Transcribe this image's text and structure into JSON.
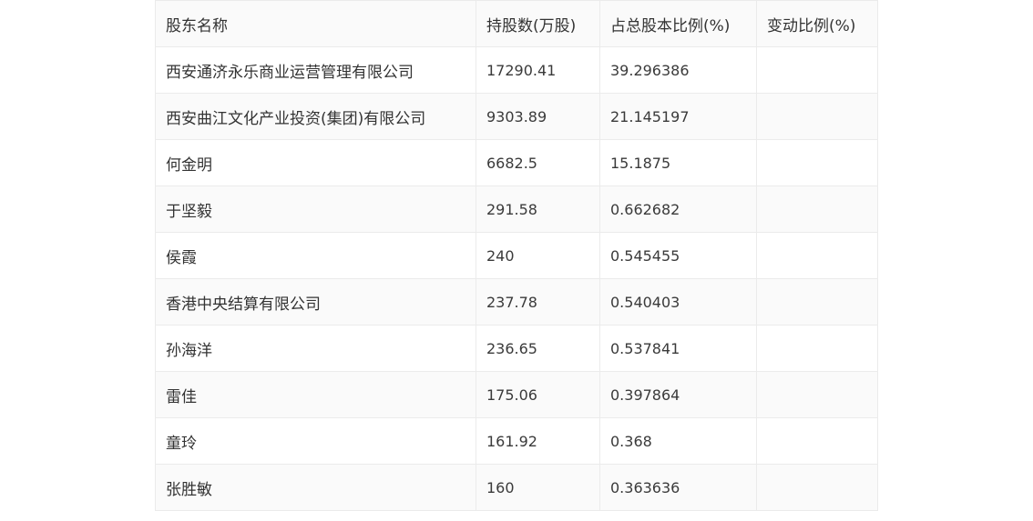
{
  "table": {
    "headers": [
      "股东名称",
      "持股数(万股)",
      "占总股本比例(%)",
      "变动比例(%)"
    ],
    "rows": [
      {
        "name": "西安通济永乐商业运营管理有限公司",
        "shares": "17290.41",
        "ratio": "39.296386",
        "change": ""
      },
      {
        "name": "西安曲江文化产业投资(集团)有限公司",
        "shares": "9303.89",
        "ratio": "21.145197",
        "change": ""
      },
      {
        "name": "何金明",
        "shares": "6682.5",
        "ratio": "15.1875",
        "change": ""
      },
      {
        "name": "于坚毅",
        "shares": "291.58",
        "ratio": "0.662682",
        "change": ""
      },
      {
        "name": "侯霞",
        "shares": "240",
        "ratio": "0.545455",
        "change": ""
      },
      {
        "name": "香港中央结算有限公司",
        "shares": "237.78",
        "ratio": "0.540403",
        "change": ""
      },
      {
        "name": "孙海洋",
        "shares": "236.65",
        "ratio": "0.537841",
        "change": ""
      },
      {
        "name": "雷佳",
        "shares": "175.06",
        "ratio": "0.397864",
        "change": ""
      },
      {
        "name": "童玲",
        "shares": "161.92",
        "ratio": "0.368",
        "change": ""
      },
      {
        "name": "张胜敏",
        "shares": "160",
        "ratio": "0.363636",
        "change": ""
      }
    ]
  }
}
